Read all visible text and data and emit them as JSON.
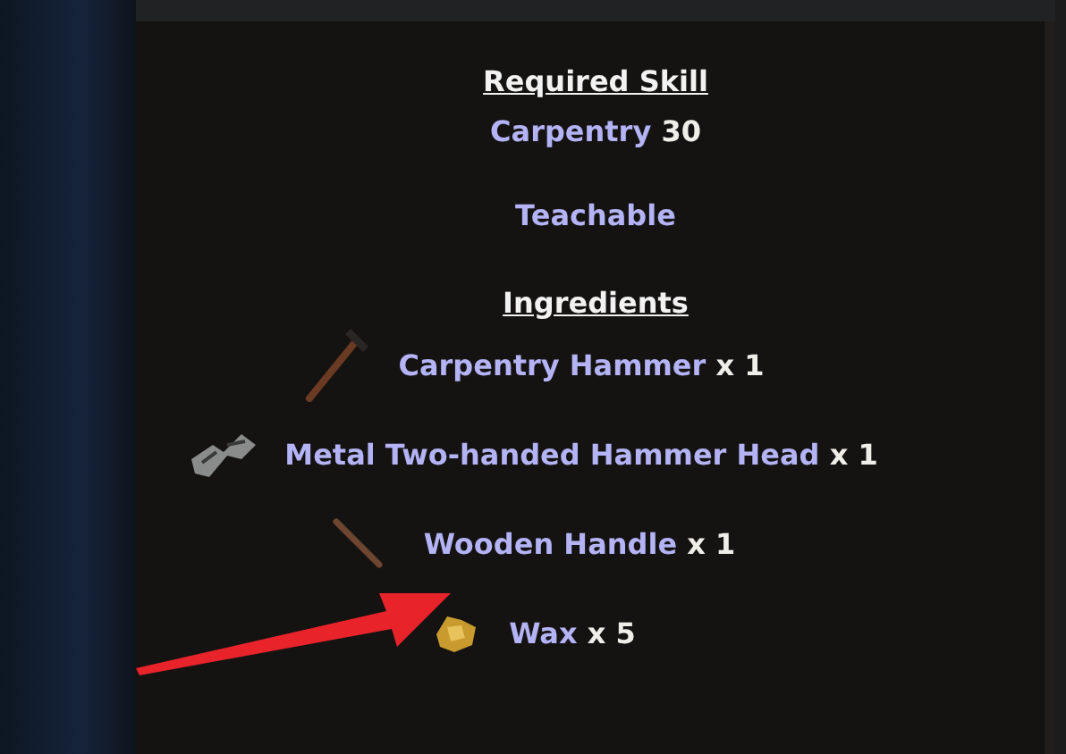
{
  "required_skill": {
    "heading": "Required Skill",
    "skill": "Carpentry",
    "level": "30"
  },
  "teachable": "Teachable",
  "ingredients": {
    "heading": "Ingredients",
    "items": [
      {
        "kind": "hammer",
        "name": "Carpentry Hammer",
        "quantity": "x 1"
      },
      {
        "kind": "hammer-head",
        "name": "Metal Two-handed Hammer Head",
        "quantity": "x 1"
      },
      {
        "kind": "handle",
        "name": "Wooden Handle",
        "quantity": "x 1"
      },
      {
        "kind": "wax",
        "name": "Wax",
        "quantity": "x 5"
      }
    ]
  }
}
